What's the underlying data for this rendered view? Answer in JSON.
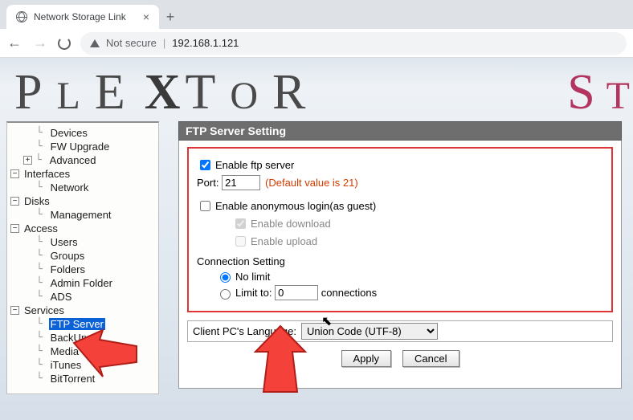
{
  "browser": {
    "tab_title": "Network Storage Link",
    "not_secure": "Not secure",
    "address": "192.168.1.121"
  },
  "logo": {
    "letters": "PleXtoR",
    "suffix": "St"
  },
  "sidebar": {
    "items": [
      {
        "label": "Devices",
        "depth": 2
      },
      {
        "label": "FW Upgrade",
        "depth": 2
      },
      {
        "label": "Advanced",
        "depth": 2,
        "toggle": "+"
      },
      {
        "label": "Interfaces",
        "depth": 1,
        "toggle": "−"
      },
      {
        "label": "Network",
        "depth": 2
      },
      {
        "label": "Disks",
        "depth": 1,
        "toggle": "−"
      },
      {
        "label": "Management",
        "depth": 2
      },
      {
        "label": "Access",
        "depth": 1,
        "toggle": "−"
      },
      {
        "label": "Users",
        "depth": 2
      },
      {
        "label": "Groups",
        "depth": 2
      },
      {
        "label": "Folders",
        "depth": 2
      },
      {
        "label": "Admin Folder",
        "depth": 2
      },
      {
        "label": "ADS",
        "depth": 2
      },
      {
        "label": "Services",
        "depth": 1,
        "toggle": "−"
      },
      {
        "label": "FTP Server",
        "depth": 2,
        "selected": true
      },
      {
        "label": "BackUp",
        "depth": 2
      },
      {
        "label": "Media",
        "depth": 2
      },
      {
        "label": "iTunes",
        "depth": 2
      },
      {
        "label": "BitTorrent",
        "depth": 2
      }
    ]
  },
  "panel": {
    "title": "FTP Server Setting",
    "enable_ftp": "Enable ftp server",
    "port_label": "Port:",
    "port_value": "21",
    "port_default": "(Default value is 21)",
    "enable_anon": "Enable anonymous login(as guest)",
    "enable_download": "Enable download",
    "enable_upload": "Enable upload",
    "conn_title": "Connection Setting",
    "no_limit": "No limit",
    "limit_to": "Limit to:",
    "limit_value": "0",
    "connections": "connections",
    "lang_label": "Client PC's Language:",
    "lang_value": "Union Code (UTF-8)",
    "apply": "Apply",
    "cancel": "Cancel"
  }
}
